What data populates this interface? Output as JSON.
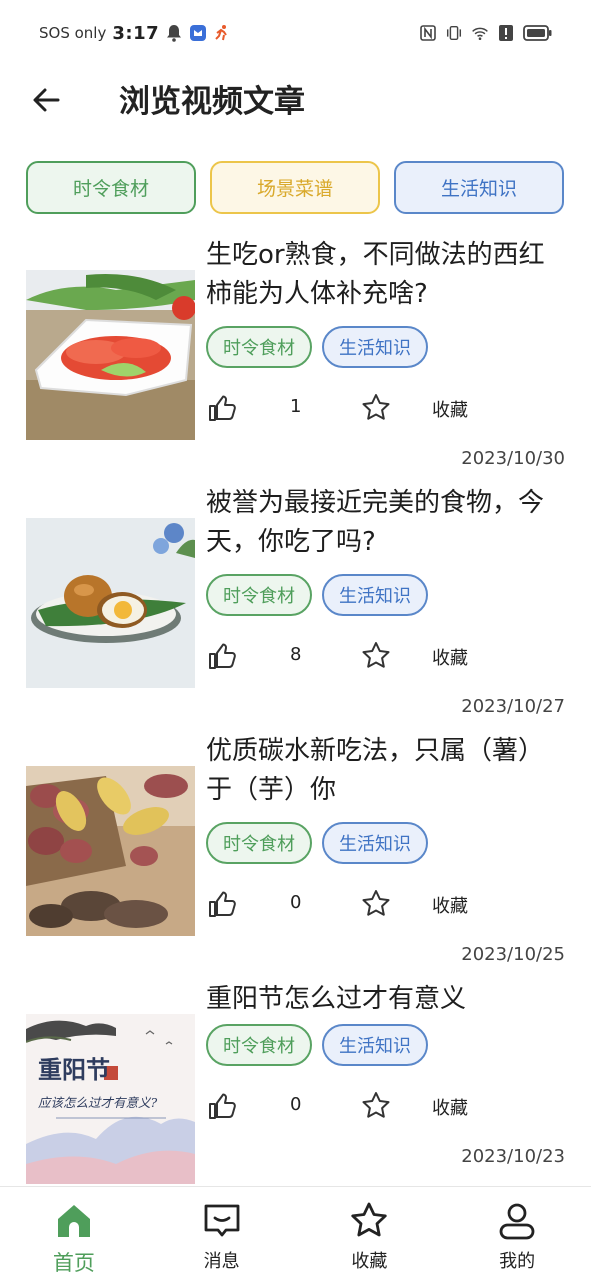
{
  "status_bar": {
    "carrier": "SOS only",
    "time": "3:17"
  },
  "header": {
    "title": "浏览视频文章"
  },
  "categories": [
    {
      "label": "时令食材",
      "color": "#4f9e5b"
    },
    {
      "label": "场景菜谱",
      "color": "#d9a92b"
    },
    {
      "label": "生活知识",
      "color": "#3f73c4"
    }
  ],
  "articles": [
    {
      "title": "生吃or熟食，不同做法的西红柿能为人体补充啥?",
      "tags": [
        "时令食材",
        "生活知识"
      ],
      "likes": "1",
      "favorite_label": "收藏",
      "date": "2023/10/30",
      "image": "tomato-plate"
    },
    {
      "title": "被誉为最接近完美的食物，今天，你吃了吗?",
      "tags": [
        "时令食材",
        "生活知识"
      ],
      "likes": "8",
      "favorite_label": "收藏",
      "date": "2023/10/27",
      "image": "eggs-plate"
    },
    {
      "title": "优质碳水新吃法，只属（薯）于（芋）你",
      "tags": [
        "时令食材",
        "生活知识"
      ],
      "likes": "0",
      "favorite_label": "收藏",
      "date": "2023/10/25",
      "image": "potatoes-box"
    },
    {
      "title": "重阳节怎么过才有意义",
      "tags": [
        "时令食材",
        "生活知识"
      ],
      "likes": "0",
      "favorite_label": "收藏",
      "date": "2023/10/23",
      "image": "chongyang-poster",
      "image_text": {
        "main": "重阳节",
        "sub": "应该怎么过才有意义?"
      }
    }
  ],
  "bottom_nav": [
    {
      "label": "首页",
      "icon": "home-icon",
      "active": true
    },
    {
      "label": "消息",
      "icon": "message-icon",
      "active": false
    },
    {
      "label": "收藏",
      "icon": "star-icon",
      "active": false
    },
    {
      "label": "我的",
      "icon": "person-icon",
      "active": false
    }
  ],
  "colors": {
    "accent_green": "#4f9e5b",
    "tag_blue": "#3f73c4",
    "tag_yellow": "#d9a92b"
  }
}
